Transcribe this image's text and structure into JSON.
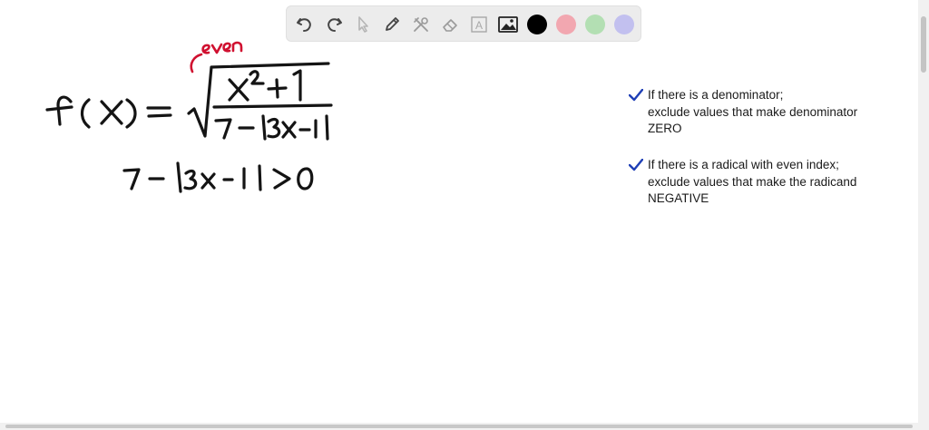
{
  "toolbar": {
    "tools": [
      {
        "name": "undo-icon"
      },
      {
        "name": "redo-icon"
      },
      {
        "name": "pointer-icon"
      },
      {
        "name": "pen-icon"
      },
      {
        "name": "tools-icon"
      },
      {
        "name": "eraser-icon"
      },
      {
        "name": "text-icon",
        "glyph": "A"
      },
      {
        "name": "image-icon"
      }
    ],
    "colors": [
      "#000000",
      "#f2a7b0",
      "#b3dfb3",
      "#c2c0ef"
    ]
  },
  "annotation": {
    "color": "#d01030",
    "text": "even"
  },
  "notes": [
    {
      "check_color": "#1f3fb6",
      "lines": [
        "If there is a denominator;",
        "exclude values that make denominator",
        "ZERO"
      ]
    },
    {
      "check_color": "#1f3fb6",
      "lines": [
        "If there is a radical with even index;",
        "exclude values that make the radicand",
        "NEGATIVE"
      ]
    }
  ]
}
